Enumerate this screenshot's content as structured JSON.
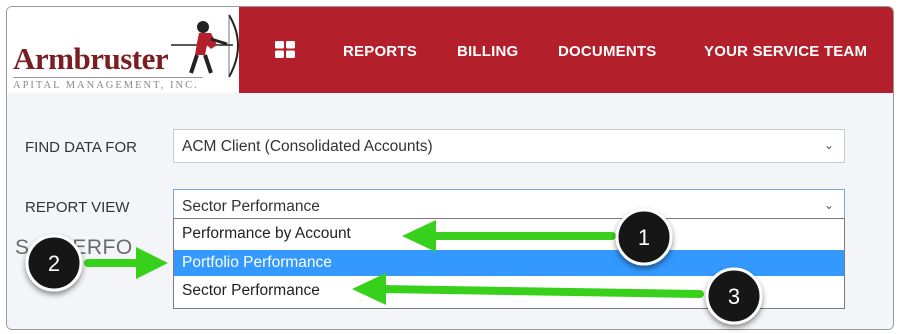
{
  "header": {
    "logo": {
      "name": "Armbruster",
      "subtitle": "APITAL MANAGEMENT, INC."
    },
    "nav": [
      {
        "label": "REPORTS"
      },
      {
        "label": "BILLING"
      },
      {
        "label": "DOCUMENTS"
      },
      {
        "label": "YOUR SERVICE TEAM"
      }
    ]
  },
  "filters": {
    "find_data_label": "FIND DATA FOR",
    "find_data_value": "ACM Client (Consolidated Accounts)",
    "report_view_label": "REPORT VIEW",
    "report_view_value": "Sector Performance",
    "report_view_options": [
      "Performance by Account",
      "Portfolio Performance",
      "Sector Performance"
    ],
    "highlighted_option": "Portfolio Performance"
  },
  "page": {
    "partial_title": "S      R PERFO"
  },
  "annotations": {
    "badges": [
      "1",
      "2",
      "3"
    ],
    "colors": {
      "arrow": "#37d11c",
      "badge": "#141414"
    }
  },
  "colors": {
    "nav_bg": "#b3202b",
    "highlight": "#3399ff",
    "logo_text": "#7a1e22"
  }
}
